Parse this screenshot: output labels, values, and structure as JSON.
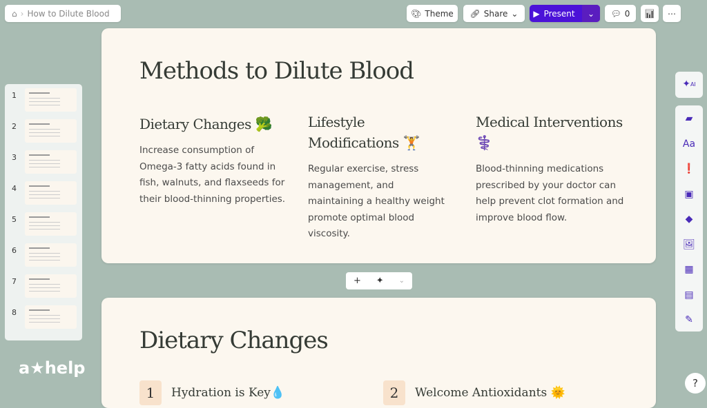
{
  "topbar": {
    "breadcrumb": "How to Dilute Blood",
    "theme": "Theme",
    "share": "Share",
    "present": "Present",
    "comments": "0"
  },
  "thumbnails": [
    {
      "num": "1"
    },
    {
      "num": "2"
    },
    {
      "num": "3"
    },
    {
      "num": "4"
    },
    {
      "num": "5"
    },
    {
      "num": "6"
    },
    {
      "num": "7"
    },
    {
      "num": "8"
    }
  ],
  "slide1": {
    "title": "Methods to Dilute Blood",
    "columns": [
      {
        "heading": "Dietary Changes",
        "emoji": "🥦",
        "body": "Increase consumption of Omega-3 fatty acids found in fish, walnuts, and flaxseeds for their blood-thinning properties."
      },
      {
        "heading": "Lifestyle Modifications",
        "emoji": "🏋️",
        "body": "Regular exercise, stress management, and maintaining a healthy weight promote optimal blood viscosity."
      },
      {
        "heading": "Medical Interventions",
        "emoji": "⚕️",
        "body": "Blood-thinning medications prescribed by your doctor can help prevent clot formation and improve blood flow."
      }
    ]
  },
  "slide2": {
    "title": "Dietary Changes",
    "items": [
      {
        "num": "1",
        "label": "Hydration is Key",
        "emoji": "💧"
      },
      {
        "num": "2",
        "label": "Welcome Antioxidants",
        "emoji": "🌞"
      }
    ]
  },
  "brand": {
    "logo": "a★help"
  },
  "colors": {
    "accent": "#4b12d8",
    "background": "#a9bcb3",
    "slide": "#fcf7ef"
  }
}
